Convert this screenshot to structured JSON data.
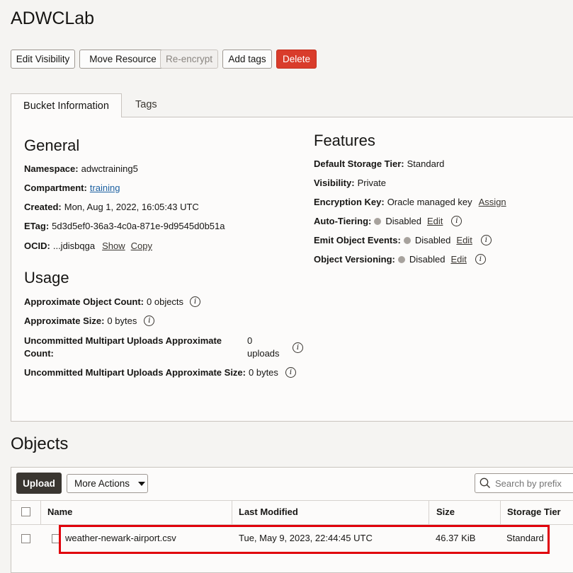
{
  "page": {
    "title": "ADWCLab"
  },
  "toolbar": {
    "edit_visibility": "Edit Visibility",
    "move_resource": "Move Resource",
    "reencrypt": "Re-encrypt",
    "add_tags": "Add tags",
    "delete": "Delete"
  },
  "tabs": {
    "bucket_info": "Bucket Information",
    "tags": "Tags"
  },
  "general": {
    "title": "General",
    "namespace_label": "Namespace:",
    "namespace_value": "adwctraining5",
    "compartment_label": "Compartment:",
    "compartment_value": "training",
    "created_label": "Created:",
    "created_value": "Mon, Aug 1, 2022, 16:05:43 UTC",
    "etag_label": "ETag:",
    "etag_value": "5d3d5ef0-36a3-4c0a-871e-9d9545d0b51a",
    "ocid_label": "OCID:",
    "ocid_value": "...jdisbqga",
    "show": "Show",
    "copy": "Copy"
  },
  "usage": {
    "title": "Usage",
    "object_count_label": "Approximate Object Count:",
    "object_count_value": "0 objects",
    "size_label": "Approximate Size:",
    "size_value": "0 bytes",
    "multipart_count_label_1": "Uncommitted Multipart Uploads Approximate",
    "multipart_count_label_2": "Count:",
    "multipart_count_value_1": "0",
    "multipart_count_value_2": "uploads",
    "multipart_size_label": "Uncommitted Multipart Uploads Approximate Size:",
    "multipart_size_value": "0 bytes"
  },
  "features": {
    "title": "Features",
    "storage_tier_label": "Default Storage Tier:",
    "storage_tier_value": "Standard",
    "visibility_label": "Visibility:",
    "visibility_value": "Private",
    "encryption_label": "Encryption Key:",
    "encryption_value": "Oracle managed key",
    "assign": "Assign",
    "auto_tiering_label": "Auto-Tiering:",
    "auto_tiering_value": "Disabled",
    "emit_events_label": "Emit Object Events:",
    "emit_events_value": "Disabled",
    "versioning_label": "Object Versioning:",
    "versioning_value": "Disabled",
    "edit": "Edit"
  },
  "objects": {
    "title": "Objects",
    "upload": "Upload",
    "more_actions": "More Actions",
    "search_placeholder": "Search by prefix",
    "columns": {
      "name": "Name",
      "last_modified": "Last Modified",
      "size": "Size",
      "storage_tier": "Storage Tier"
    },
    "rows": [
      {
        "name": "weather-newark-airport.csv",
        "last_modified": "Tue, May 9, 2023, 22:44:45 UTC",
        "size": "46.37 KiB",
        "storage_tier": "Standard"
      }
    ]
  },
  "colors": {
    "danger": "#d93c2b",
    "link": "#1a5fa0",
    "highlight": "#e0000b",
    "primary_button": "#3a3631"
  }
}
